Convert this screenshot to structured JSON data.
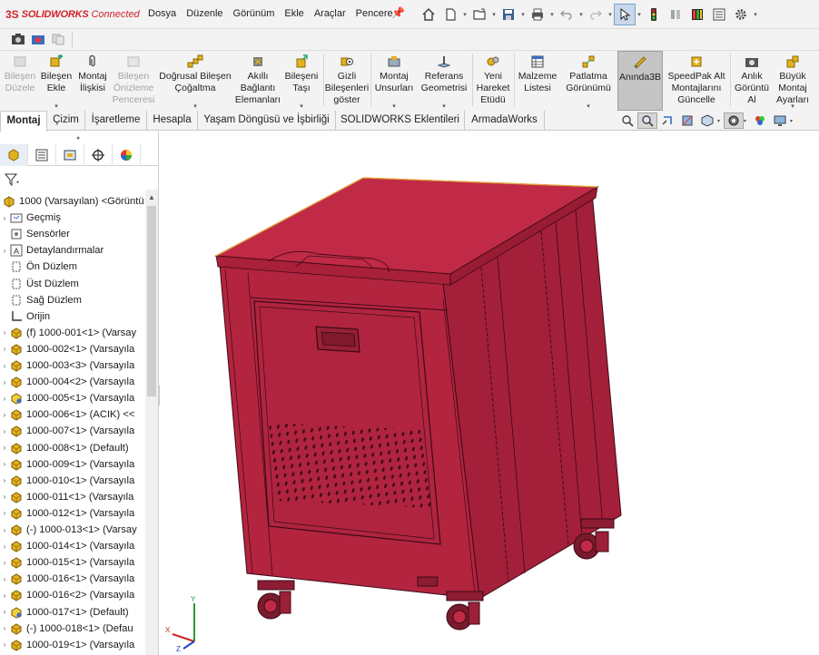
{
  "app": {
    "logo_ds": "3S",
    "logo_name": "SOLIDWORKS",
    "logo_suffix": "Connected"
  },
  "menu": [
    "Dosya",
    "Düzenle",
    "Görünüm",
    "Ekle",
    "Araçlar",
    "Pencere"
  ],
  "command_manager": [
    {
      "label": "Bileşen\nDüzele",
      "disabled": true
    },
    {
      "label": "Bileşen\nEkle",
      "disabled": false
    },
    {
      "label": "Montaj\nİlişkisi",
      "disabled": false
    },
    {
      "label": "Bileşen\nÖnizleme\nPenceresi",
      "disabled": true
    },
    {
      "label": "Doğrusal Bileşen\nÇoğaltma",
      "disabled": false
    },
    {
      "label": "Akıllı\nBağlantı\nElemanları",
      "disabled": false
    },
    {
      "label": "Bileşeni\nTaşı",
      "disabled": false
    },
    {
      "label": "Gizli\nBileşenleri\ngöster",
      "disabled": false
    },
    {
      "label": "Montaj\nUnsurları",
      "disabled": false
    },
    {
      "label": "Referans\nGeometrisi",
      "disabled": false
    },
    {
      "label": "Yeni\nHareket\nEtüdü",
      "disabled": false
    },
    {
      "label": "Malzeme\nListesi",
      "disabled": false
    },
    {
      "label": "Patlatma\nGörünümü",
      "disabled": false
    },
    {
      "label": "Anında3B",
      "disabled": false
    },
    {
      "label": "SpeedPak Alt\nMontajlarını\nGüncelle",
      "disabled": false
    },
    {
      "label": "Anlık\nGörüntü\nAl",
      "disabled": false
    },
    {
      "label": "Büyük\nMontaj\nAyarları",
      "disabled": false
    }
  ],
  "tabs": [
    "Montaj",
    "Çizim",
    "İşaretleme",
    "Hesapla",
    "Yaşam Döngüsü ve İşbirliği",
    "SOLIDWORKS Eklentileri",
    "ArmadaWorks"
  ],
  "active_tab": "Montaj",
  "tree": [
    {
      "label": "1000 (Varsayılan) <Görüntü",
      "icon": "assembly-icon",
      "expander": ""
    },
    {
      "label": "Geçmiş",
      "icon": "history-icon",
      "expander": "›"
    },
    {
      "label": "Sensörler",
      "icon": "sensor-icon",
      "expander": ""
    },
    {
      "label": "Detaylandırmalar",
      "icon": "annotation-icon",
      "expander": "›"
    },
    {
      "label": "Ön Düzlem",
      "icon": "plane-icon",
      "expander": ""
    },
    {
      "label": "Üst Düzlem",
      "icon": "plane-icon",
      "expander": ""
    },
    {
      "label": "Sağ Düzlem",
      "icon": "plane-icon",
      "expander": ""
    },
    {
      "label": "Orijin",
      "icon": "origin-icon",
      "expander": ""
    },
    {
      "label": "(f) 1000-001<1> (Varsay",
      "icon": "part-icon",
      "expander": "›"
    },
    {
      "label": "1000-002<1> (Varsayıla",
      "icon": "part-icon",
      "expander": "›"
    },
    {
      "label": "1000-003<3> (Varsayıla",
      "icon": "part-icon",
      "expander": "›"
    },
    {
      "label": "1000-004<2> (Varsayıla",
      "icon": "part-icon",
      "expander": "›"
    },
    {
      "label": "1000-005<1> (Varsayıla",
      "icon": "part-yellow-icon",
      "expander": "›"
    },
    {
      "label": "1000-006<1> (ACIK) <<",
      "icon": "part-icon",
      "expander": "›"
    },
    {
      "label": "1000-007<1> (Varsayıla",
      "icon": "part-icon",
      "expander": "›"
    },
    {
      "label": "1000-008<1> (Default)",
      "icon": "part-icon",
      "expander": "›"
    },
    {
      "label": "1000-009<1> (Varsayıla",
      "icon": "part-icon",
      "expander": "›"
    },
    {
      "label": "1000-010<1> (Varsayıla",
      "icon": "part-icon",
      "expander": "›"
    },
    {
      "label": "1000-011<1> (Varsayıla",
      "icon": "part-icon",
      "expander": "›"
    },
    {
      "label": "1000-012<1> (Varsayıla",
      "icon": "part-icon",
      "expander": "›"
    },
    {
      "label": "(-) 1000-013<1> (Varsay",
      "icon": "part-icon",
      "expander": "›"
    },
    {
      "label": "1000-014<1> (Varsayıla",
      "icon": "part-icon",
      "expander": "›"
    },
    {
      "label": "1000-015<1> (Varsayıla",
      "icon": "part-icon",
      "expander": "›"
    },
    {
      "label": "1000-016<1> (Varsayıla",
      "icon": "part-icon",
      "expander": "›"
    },
    {
      "label": "1000-016<2> (Varsayıla",
      "icon": "part-icon",
      "expander": "›"
    },
    {
      "label": "1000-017<1> (Default)",
      "icon": "part-yellow-icon",
      "expander": "›"
    },
    {
      "label": "(-) 1000-018<1> (Defau",
      "icon": "part-icon",
      "expander": "›"
    },
    {
      "label": "1000-019<1> (Varsayıla",
      "icon": "part-icon",
      "expander": "›"
    }
  ],
  "colors": {
    "model_body": "#b3243f",
    "model_top": "#c02a46",
    "model_edge": "#3b0a16",
    "brand_red": "#d0232b",
    "selected_tool": "#c4c4c4"
  }
}
